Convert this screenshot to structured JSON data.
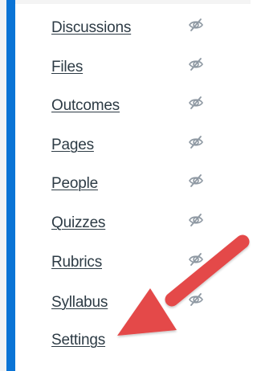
{
  "navigation": {
    "items": [
      {
        "label": "Discussions",
        "visibility_icon": "eye-slash-icon"
      },
      {
        "label": "Files",
        "visibility_icon": "eye-slash-icon"
      },
      {
        "label": "Outcomes",
        "visibility_icon": "eye-slash-icon"
      },
      {
        "label": "Pages",
        "visibility_icon": "eye-slash-icon"
      },
      {
        "label": "People",
        "visibility_icon": "eye-slash-icon"
      },
      {
        "label": "Quizzes",
        "visibility_icon": "eye-slash-icon"
      },
      {
        "label": "Rubrics",
        "visibility_icon": "eye-slash-icon"
      },
      {
        "label": "Syllabus",
        "visibility_icon": "eye-slash-icon"
      },
      {
        "label": "Settings"
      }
    ]
  },
  "colors": {
    "accent_bar": "#0a74d6",
    "link_text": "#2d3b45",
    "icon": "#8f99a3",
    "arrow": "#e44a4a"
  },
  "annotation": {
    "arrow_icon": "red-arrow-icon"
  }
}
